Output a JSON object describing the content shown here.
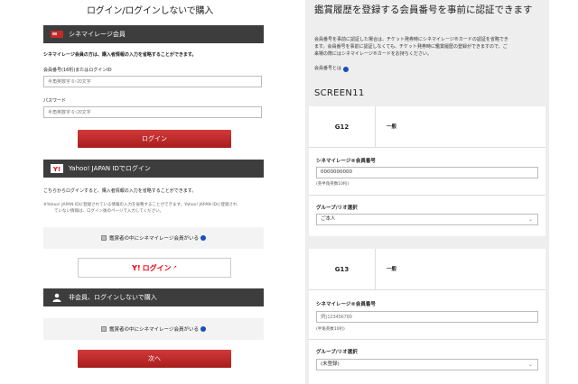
{
  "left": {
    "title": "ログイン/ログインしないで購入",
    "cinemileage": {
      "header": "シネマイレージ会員",
      "notice": "シネマイレージ会員の方は、購入者情報の入力を省略することができます。",
      "member_label": "会員番号(16桁)またはログインID",
      "member_placeholder": "半角英数字 6~20文字",
      "password_label": "パスワード",
      "password_placeholder": "半角英数字 6~20文字",
      "login_button": "ログイン"
    },
    "yahoo": {
      "header": "Yahoo! JAPAN IDでログイン",
      "notice": "こちらからログインすると、購入者情報の入力を省略することができます。",
      "note_line1": "※Yahoo! JAPAN IDに登録されている情報の入力を省略することができます。Yahoo! JAPAN IDに登録され",
      "note_line2": "ていない情報は、ログイン後のページで入力してください。",
      "checkbox_label": "鑑賞者の中にシネマイレージ会員がいる",
      "button_logo": "Y!",
      "button_label": "ログイン"
    },
    "guest": {
      "header": "非会員、ログインしないで購入",
      "checkbox_label": "鑑賞者の中にシネマイレージ会員がいる",
      "next_button": "次へ"
    }
  },
  "right": {
    "title": "鑑賞履歴を登録する会員番号を事前に認証できます",
    "desc_line1": "会員番号を事前に認証した場合は、チケット発券時にシネマイレージ®カードの認証を省略でき",
    "desc_line2": "ます。会員番号を事前に認証しなくても、チケット発券時に鑑賞履歴の登録ができますので、ご",
    "desc_line3": "来場の際にはシネマイレージ®カードをお持ちください。",
    "help_link": "会員番号とは",
    "screen": "SCREEN11",
    "seats": [
      {
        "seat": "G12",
        "type": "一般",
        "member_label": "シネマイレージ®会員番号",
        "member_value": "0000000000",
        "member_note": "(英半角英数10桁)",
        "group_label": "グループ/リオ選択",
        "group_value": "ご本人"
      },
      {
        "seat": "G13",
        "type": "一般",
        "member_label": "シネマイレージ®会員番号",
        "member_value": "例)123456789",
        "member_note": "(半角英数10桁)",
        "group_label": "グループ/リオ選択",
        "group_value": "(未登録)"
      }
    ]
  },
  "colors": {
    "accent_red": "#c32a2a",
    "band_dark": "#3d3d3d",
    "link_blue": "#1a4fb5"
  }
}
